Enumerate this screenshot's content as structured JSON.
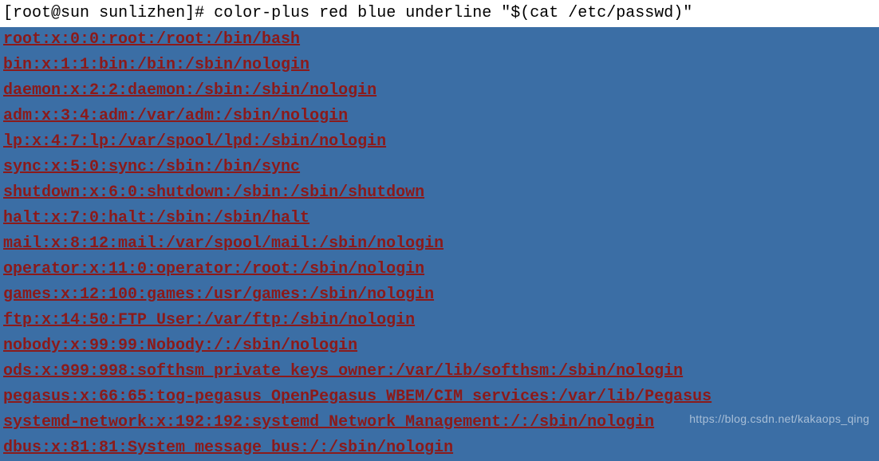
{
  "prompt": {
    "user": "root",
    "host": "sun",
    "cwd": "sunlizhen",
    "symbol": "#",
    "command": "color-plus red blue underline \"$(cat /etc/passwd)\""
  },
  "output_lines": [
    "root:x:0:0:root:/root:/bin/bash",
    "bin:x:1:1:bin:/bin:/sbin/nologin",
    "daemon:x:2:2:daemon:/sbin:/sbin/nologin",
    "adm:x:3:4:adm:/var/adm:/sbin/nologin",
    "lp:x:4:7:lp:/var/spool/lpd:/sbin/nologin",
    "sync:x:5:0:sync:/sbin:/bin/sync",
    "shutdown:x:6:0:shutdown:/sbin:/sbin/shutdown",
    "halt:x:7:0:halt:/sbin:/sbin/halt",
    "mail:x:8:12:mail:/var/spool/mail:/sbin/nologin",
    "operator:x:11:0:operator:/root:/sbin/nologin",
    "games:x:12:100:games:/usr/games:/sbin/nologin",
    "ftp:x:14:50:FTP User:/var/ftp:/sbin/nologin",
    "nobody:x:99:99:Nobody:/:/sbin/nologin",
    "ods:x:999:998:softhsm private keys owner:/var/lib/softhsm:/sbin/nologin",
    "pegasus:x:66:65:tog-pegasus OpenPegasus WBEM/CIM services:/var/lib/Pegasus",
    "systemd-network:x:192:192:systemd Network Management:/:/sbin/nologin",
    "dbus:x:81:81:System message bus:/:/sbin/nologin"
  ],
  "watermark": "https://blog.csdn.net/kakaops_qing",
  "colors": {
    "bg_blue": "#3b6ea5",
    "fg_red": "#8b1a1a"
  }
}
